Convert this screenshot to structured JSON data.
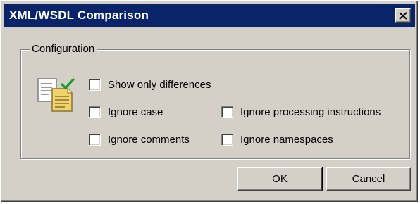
{
  "window": {
    "title": "XML/WSDL Comparison",
    "title_bar_color": "#0a246a",
    "close_icon": "close-icon"
  },
  "configuration": {
    "group_label": "Configuration",
    "icon": "document-compare-icon",
    "options": {
      "show_only_differences": {
        "label": "Show only differences",
        "checked": false
      },
      "ignore_case": {
        "label": "Ignore case",
        "checked": false
      },
      "ignore_processing_instructions": {
        "label": "Ignore processing instructions",
        "checked": false
      },
      "ignore_comments": {
        "label": "Ignore comments",
        "checked": false
      },
      "ignore_namespaces": {
        "label": "Ignore namespaces",
        "checked": false
      }
    }
  },
  "buttons": {
    "ok": "OK",
    "cancel": "Cancel"
  }
}
